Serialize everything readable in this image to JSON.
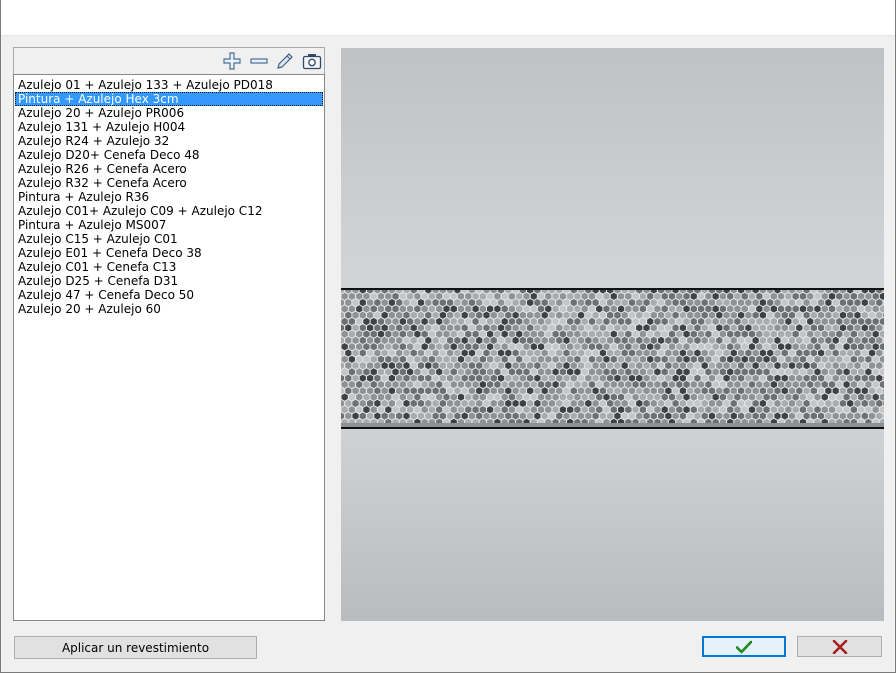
{
  "colors": {
    "selection": "#3399ff",
    "ok_check": "#1e8a1e",
    "cancel_x": "#a52020",
    "default_button_border": "#0078d7"
  },
  "toolbar": {
    "add_icon": "plus-icon",
    "remove_icon": "minus-icon",
    "edit_icon": "pencil-icon",
    "capture_icon": "camera-icon"
  },
  "coatings": {
    "selected_index": 1,
    "items": [
      "Azulejo 01 + Azulejo 133 + Azulejo PD018",
      "Pintura + Azulejo Hex 3cm",
      "Azulejo 20 + Azulejo PR006",
      "Azulejo 131 + Azulejo H004",
      "Azulejo R24 + Azulejo 32",
      "Azulejo D20+ Cenefa Deco 48",
      "Azulejo R26 + Cenefa Acero",
      "Azulejo R32 + Cenefa Acero",
      "Pintura + Azulejo R36",
      "Azulejo C01+ Azulejo C09 + Azulejo C12",
      "Pintura + Azulejo MS007",
      "Azulejo C15 + Azulejo C01",
      "Azulejo E01 + Cenefa Deco 38",
      "Azulejo C01 + Cenefa C13",
      "Azulejo D25 + Cenefa D31",
      "Azulejo 47 + Cenefa Deco 50",
      "Azulejo 20 + Azulejo 60"
    ]
  },
  "buttons": {
    "apply_label": "Aplicar un revestimiento",
    "ok_icon": "check-icon",
    "cancel_icon": "close-icon"
  }
}
